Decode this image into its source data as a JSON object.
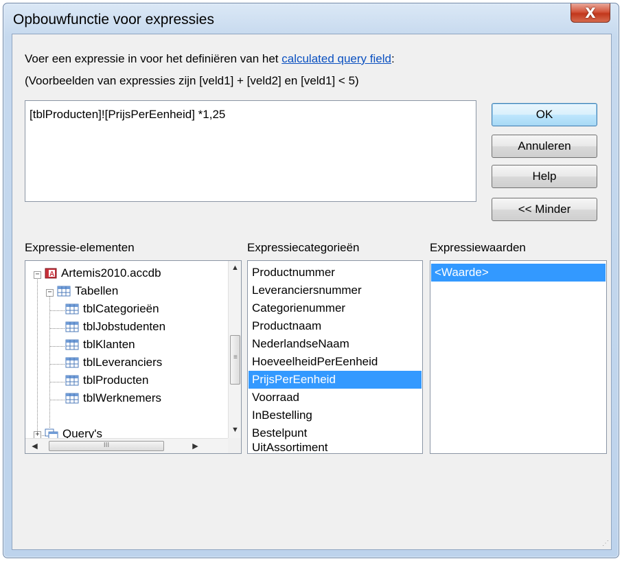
{
  "window": {
    "title": "Opbouwfunctie voor expressies",
    "close_label": "X"
  },
  "description": {
    "line1_prefix": "Voer een expressie in voor het definiëren van het ",
    "line1_link": "calculated query field",
    "line1_suffix": ":",
    "line2": "(Voorbeelden van expressies zijn [veld1] + [veld2] en [veld1] < 5)"
  },
  "expression": {
    "value": "[tblProducten]![PrijsPerEenheid] *1,25"
  },
  "buttons": {
    "ok": "OK",
    "cancel": "Annuleren",
    "help": "Help",
    "less": "<< Minder"
  },
  "elements_panel": {
    "label": "Expressie-elementen",
    "tree": {
      "root": "Artemis2010.accdb",
      "tables_folder": "Tabellen",
      "tables": [
        "tblCategorieën",
        "tblJobstudenten",
        "tblKlanten",
        "tblLeveranciers",
        "tblProducten",
        "tblWerknemers"
      ],
      "queries_folder": "Query's"
    },
    "hscroll_grip": "III"
  },
  "categories_panel": {
    "label": "Expressiecategorieën",
    "items": [
      "Productnummer",
      "Leveranciersnummer",
      "Categorienummer",
      "Productnaam",
      "NederlandseNaam",
      "HoeveelheidPerEenheid",
      "PrijsPerEenheid",
      "Voorraad",
      "InBestelling",
      "Bestelpunt",
      "UitAssortiment"
    ],
    "selected": "PrijsPerEenheid"
  },
  "values_panel": {
    "label": "Expressiewaarden",
    "items": [
      "<Waarde>"
    ],
    "selected": "<Waarde>"
  },
  "colors": {
    "selection": "#3399ff",
    "link": "#0a50c0",
    "close_button": "#c1371c"
  }
}
